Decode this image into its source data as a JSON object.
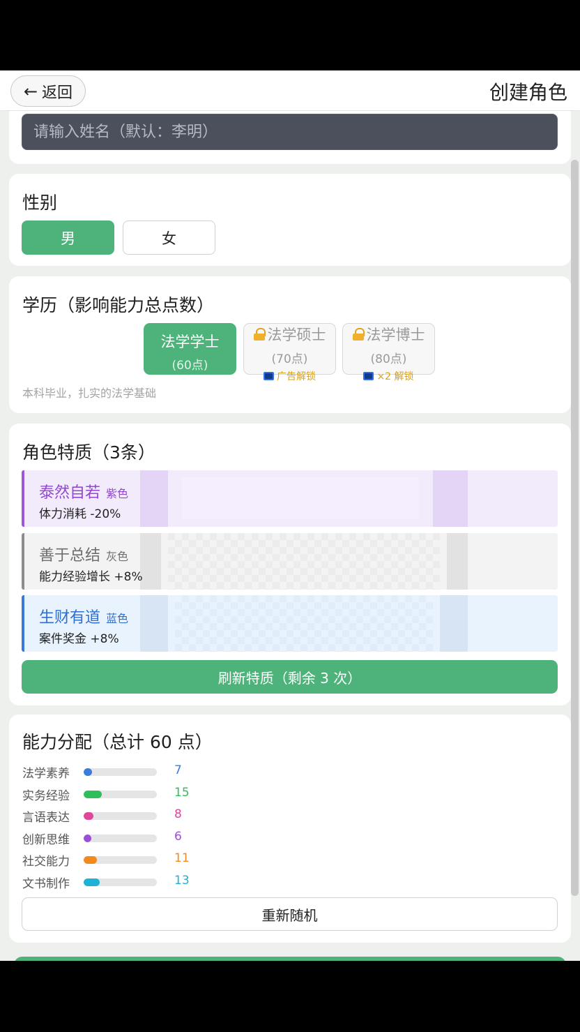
{
  "header": {
    "back_label": "返回",
    "title": "创建角色"
  },
  "name_input": {
    "placeholder": "请输入姓名（默认：李明）",
    "value": ""
  },
  "gender": {
    "title": "性别",
    "options": [
      "男",
      "女"
    ],
    "selected": "男"
  },
  "education": {
    "title": "学历（影响能力总点数）",
    "options": [
      {
        "name": "法学学士",
        "points": "(60点)",
        "selected": true
      },
      {
        "name": "法学硕士",
        "points": "(70点)",
        "unlock": "广告解锁",
        "locked": true
      },
      {
        "name": "法学博士",
        "points": "(80点)",
        "unlock": "×2 解锁",
        "locked": true
      }
    ],
    "description": "本科毕业，扎实的法学基础"
  },
  "traits": {
    "title": "角色特质（3条）",
    "items": [
      {
        "name": "泰然自若",
        "rarity": "紫色",
        "effect": "体力消耗 -20%",
        "color": "#9347d1"
      },
      {
        "name": "善于总结",
        "rarity": "灰色",
        "effect": "能力经验增长 +8%",
        "color": "#6e6e6e"
      },
      {
        "name": "生财有道",
        "rarity": "蓝色",
        "effect": "案件奖金 +8%",
        "color": "#2f6fce"
      }
    ],
    "refresh_label": "刷新特质（剩余 3 次）"
  },
  "abilities": {
    "title": "能力分配（总计 60 点）",
    "max": 60,
    "items": [
      {
        "label": "法学素养",
        "value": 7,
        "color": "#3b7ddd"
      },
      {
        "label": "实务经验",
        "value": 15,
        "color": "#2fbf5a"
      },
      {
        "label": "言语表达",
        "value": 8,
        "color": "#e0479a"
      },
      {
        "label": "创新思维",
        "value": 6,
        "color": "#9b4fd6"
      },
      {
        "label": "社交能力",
        "value": 11,
        "color": "#f08a1c"
      },
      {
        "label": "文书制作",
        "value": 13,
        "color": "#1fb2d4"
      }
    ],
    "reroll_label": "重新随机"
  },
  "colors": {
    "accent": "#4db37b",
    "input_bg": "#4b505c",
    "lock": "#f1b02c"
  }
}
